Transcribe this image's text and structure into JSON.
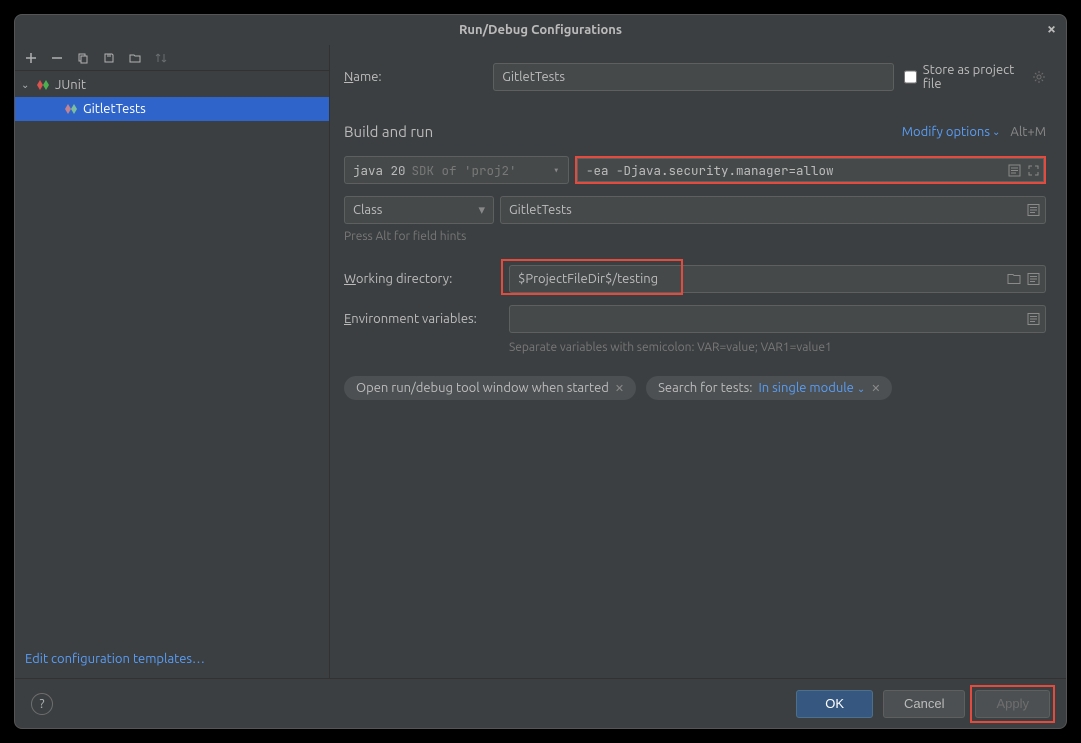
{
  "window": {
    "title": "Run/Debug Configurations"
  },
  "toolbar_icons": [
    "add",
    "remove",
    "copy",
    "save",
    "folder",
    "sort"
  ],
  "tree": {
    "category": "JUnit",
    "selected_config": "GitletTests"
  },
  "sidebar_footer_link": "Edit configuration templates…",
  "form": {
    "name_label": "Name:",
    "name_value": "GitletTests",
    "store_label": "Store as project file",
    "build_section": "Build and run",
    "modify_label": "Modify options",
    "modify_hint": "Alt+M",
    "sdk_main": "java 20",
    "sdk_dim": "SDK of 'proj2'",
    "vm_options": "-ea -Djava.security.manager=allow",
    "class_type": "Class",
    "class_value": "GitletTests",
    "field_hint": "Press Alt for field hints",
    "wd_label": "Working directory:",
    "wd_value": "$ProjectFileDir$/testing",
    "env_label": "Environment variables:",
    "env_value": "",
    "env_hint": "Separate variables with semicolon: VAR=value; VAR1=value1",
    "tag1": "Open run/debug tool window when started",
    "tag2_prefix": "Search for tests: ",
    "tag2_link": "In single module"
  },
  "buttons": {
    "ok": "OK",
    "cancel": "Cancel",
    "apply": "Apply"
  }
}
